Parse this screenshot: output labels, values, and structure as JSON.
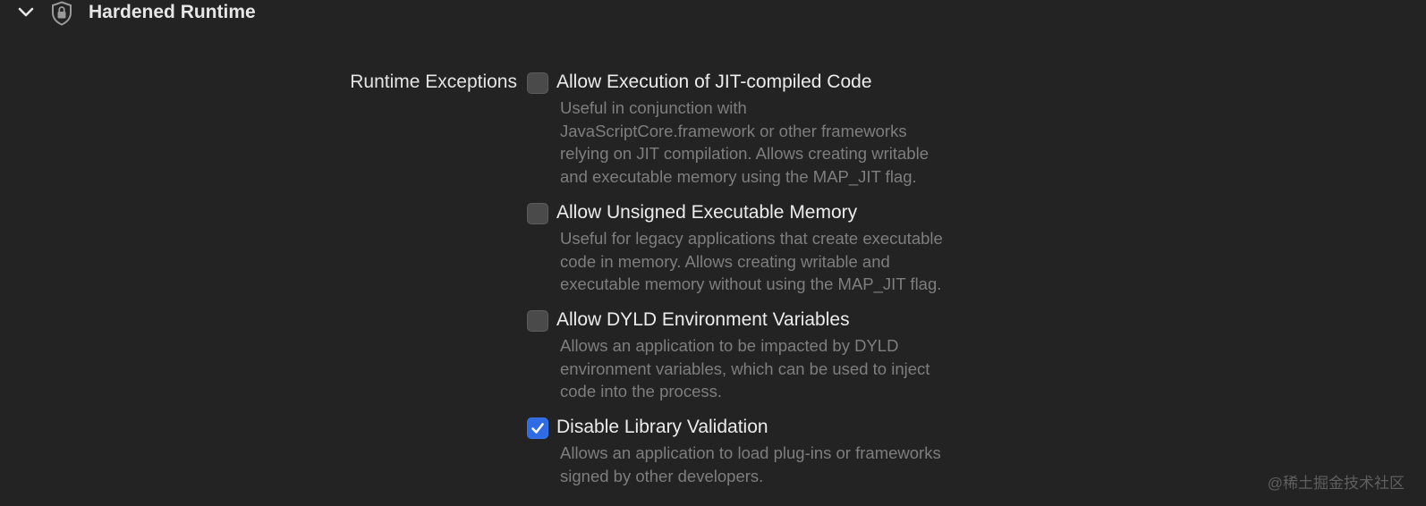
{
  "section": {
    "title": "Hardened Runtime",
    "expanded": true,
    "chevron_icon": "chevron-down-icon",
    "icon": "shield-lock-icon"
  },
  "runtime_exceptions": {
    "label": "Runtime Exceptions",
    "options": [
      {
        "label": "Allow Execution of JIT-compiled Code",
        "checked": false,
        "description": [
          "Useful in conjunction with",
          "JavaScriptCore.framework or other frameworks",
          "relying on JIT compilation. Allows creating writable",
          "and executable memory using the MAP_JIT flag."
        ]
      },
      {
        "label": "Allow Unsigned Executable Memory",
        "checked": false,
        "description": [
          "Useful for legacy applications that create executable",
          "code in memory. Allows creating writable and",
          "executable memory without using the MAP_JIT flag."
        ]
      },
      {
        "label": "Allow DYLD Environment Variables",
        "checked": false,
        "description": [
          "Allows an application to be impacted by DYLD",
          "environment variables, which can be used to inject",
          "code into the process."
        ]
      },
      {
        "label": "Disable Library Validation",
        "checked": true,
        "description": [
          "Allows an application to load plug-ins or frameworks",
          "signed by other developers."
        ]
      }
    ]
  },
  "watermark": "@稀土掘金技术社区",
  "colors": {
    "background": "#232323",
    "checkbox_checked": "#2f6be4",
    "checkbox_unchecked": "#4a4a4a",
    "description_text": "#7e7e7e"
  }
}
